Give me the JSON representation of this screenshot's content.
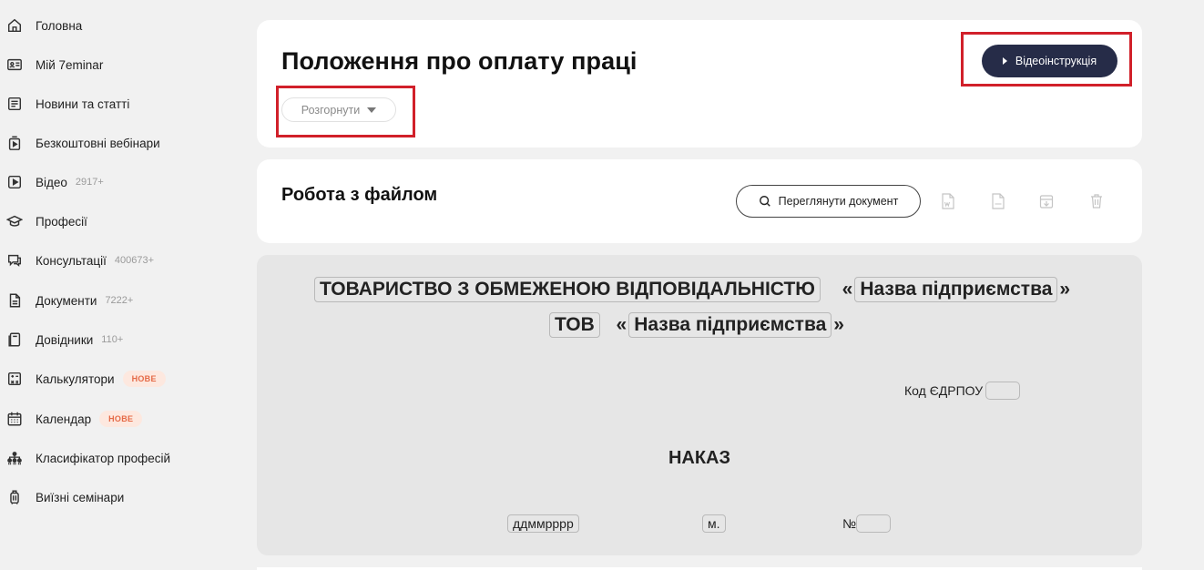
{
  "sidebar": {
    "items": [
      {
        "icon": "home-icon",
        "label": "Головна",
        "count": "",
        "badge": ""
      },
      {
        "icon": "id-card-icon",
        "label": "Мій 7eminar",
        "count": "",
        "badge": ""
      },
      {
        "icon": "newspaper-icon",
        "label": "Новини та статті",
        "count": "",
        "badge": ""
      },
      {
        "icon": "webinar-icon",
        "label": "Безкоштовні вебінари",
        "count": "",
        "badge": ""
      },
      {
        "icon": "video-icon",
        "label": "Відео",
        "count": "2917+",
        "badge": ""
      },
      {
        "icon": "graduation-cap-icon",
        "label": "Професії",
        "count": "",
        "badge": ""
      },
      {
        "icon": "chat-icon",
        "label": "Консультації",
        "count": "400673+",
        "badge": ""
      },
      {
        "icon": "document-icon",
        "label": "Документи",
        "count": "7222+",
        "badge": ""
      },
      {
        "icon": "book-icon",
        "label": "Довідники",
        "count": "110+",
        "badge": ""
      },
      {
        "icon": "calculator-icon",
        "label": "Калькулятори",
        "count": "",
        "badge": "НОВЕ"
      },
      {
        "icon": "calendar-icon",
        "label": "Календар",
        "count": "",
        "badge": "НОВЕ"
      },
      {
        "icon": "hierarchy-icon",
        "label": "Класифікатор професій",
        "count": "",
        "badge": ""
      },
      {
        "icon": "suitcase-icon",
        "label": "Виїзні семінари",
        "count": "",
        "badge": ""
      }
    ]
  },
  "header": {
    "title": "Положення про оплату праці",
    "expand_label": "Розгорнути",
    "video_label": "Відеоінструкція"
  },
  "file_section": {
    "title": "Робота з файлом",
    "view_label": "Переглянути документ",
    "icons": [
      "word-file-icon",
      "pdf-file-icon",
      "download-icon",
      "trash-icon"
    ]
  },
  "document": {
    "company_type": "ТОВАРИСТВО З ОБМЕЖЕНОЮ ВІДПОВІДАЛЬНІСТЮ",
    "company_name_placeholder": "Назва підприємства",
    "company_short": "ТОВ",
    "company_short_name_placeholder": "Назва підприємства",
    "quote_open": "«",
    "quote_close": "»",
    "edrpou_label": "Код ЄДРПОУ",
    "order_title": "НАКАЗ",
    "date_placeholder": "ддммрррр",
    "city_placeholder": "м.",
    "number_label": "№"
  },
  "colors": {
    "accent_dark": "#262c48",
    "highlight_red": "#d1202a",
    "badge_text": "#e56a47",
    "badge_bg": "#fde8df"
  }
}
